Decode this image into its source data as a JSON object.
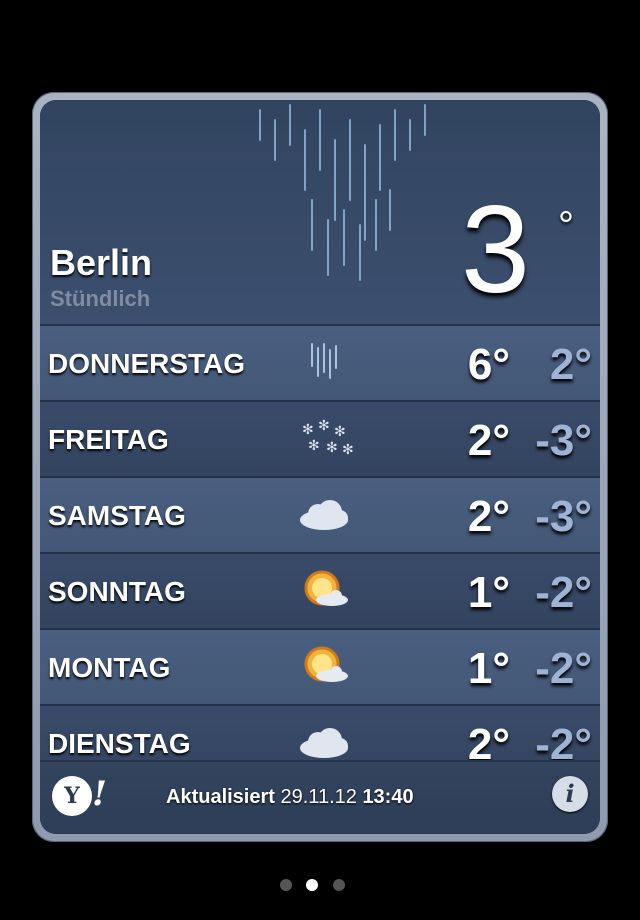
{
  "header": {
    "city": "Berlin",
    "mode": "Stündlich",
    "current_temp": "3",
    "degree_symbol": "°",
    "condition_icon": "rain-icon"
  },
  "forecast": [
    {
      "day": "DONNERSTAG",
      "high": "6°",
      "low": "2°",
      "icon": "rain-icon"
    },
    {
      "day": "FREITAG",
      "high": "2°",
      "low": "-3°",
      "icon": "snow-icon"
    },
    {
      "day": "SAMSTAG",
      "high": "2°",
      "low": "-3°",
      "icon": "cloud-icon"
    },
    {
      "day": "SONNTAG",
      "high": "1°",
      "low": "-2°",
      "icon": "sun-cloud-icon"
    },
    {
      "day": "MONTAG",
      "high": "1°",
      "low": "-2°",
      "icon": "sun-cloud-icon"
    },
    {
      "day": "DIENSTAG",
      "high": "2°",
      "low": "-2°",
      "icon": "cloud-icon"
    }
  ],
  "footer": {
    "updated_label": "Aktualisiert",
    "updated_date": "29.11.12",
    "updated_time": "13:40",
    "yahoo_y": "Y",
    "yahoo_bang": "!",
    "info": "i"
  },
  "pagination": {
    "total": 3,
    "active_index": 1
  },
  "colors": {
    "low_temp": "#9fb3d6",
    "card_bg": "#3a4d6c"
  }
}
